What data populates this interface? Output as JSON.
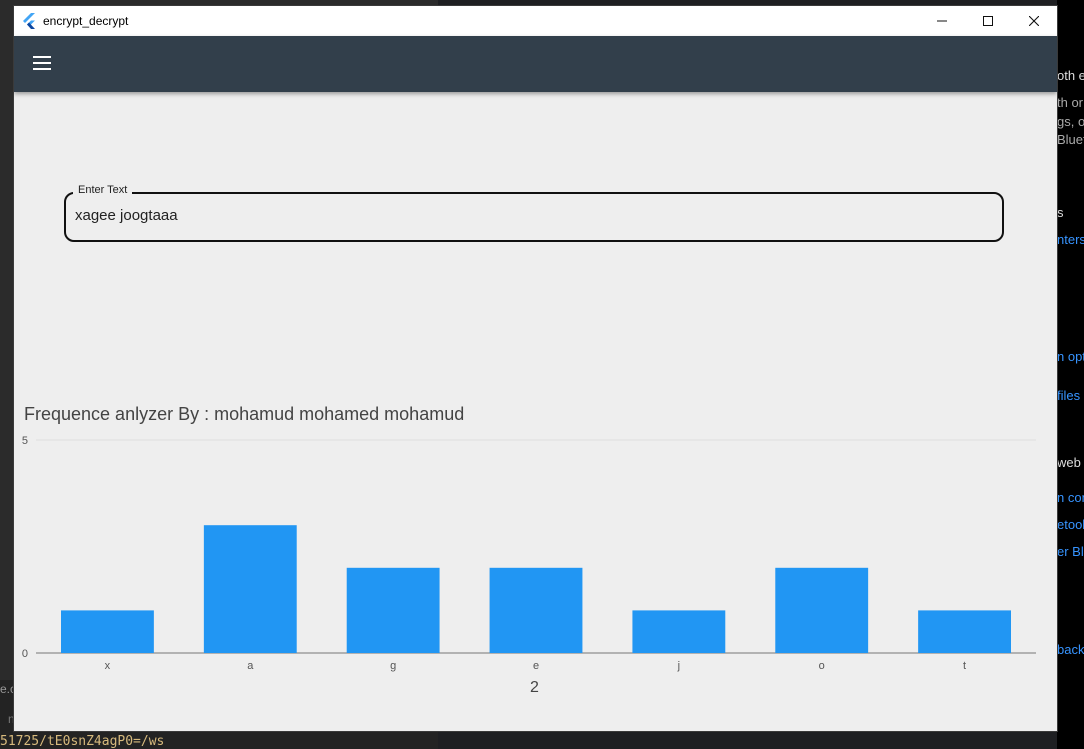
{
  "window": {
    "title": "encrypt_decrypt",
    "controls": [
      "minimize",
      "maximize",
      "close"
    ]
  },
  "appbar": {
    "menu_icon": "hamburger-menu-icon"
  },
  "input": {
    "label": "Enter Text",
    "value": "xagee joogtaaa"
  },
  "chart_title": "Frequence anlyzer By : mohamud mohamed mohamud",
  "page_number": "2",
  "chart_data": {
    "type": "bar",
    "categories": [
      "x",
      "a",
      "g",
      "e",
      "j",
      "o",
      "t"
    ],
    "values": [
      1,
      3,
      2,
      2,
      1,
      2,
      1
    ],
    "ylim": [
      0,
      5
    ],
    "yticks": [
      "0",
      "5"
    ],
    "bar_color": "#2196f3",
    "grid": true
  },
  "background": {
    "right_fragments": [
      {
        "text": "oth e",
        "color": "#dddddd"
      },
      {
        "text": "th or",
        "color": "#aaaaaa"
      },
      {
        "text": "gs, op",
        "color": "#aaaaaa"
      },
      {
        "text": "Blueto",
        "color": "#aaaaaa"
      },
      {
        "text": "s",
        "color": "#dddddd"
      },
      {
        "text": "nters",
        "color": "#3794ff"
      },
      {
        "text": "n opti",
        "color": "#3794ff"
      },
      {
        "text": "files",
        "color": "#3794ff"
      },
      {
        "text": "web",
        "color": "#dddddd"
      },
      {
        "text": "n con",
        "color": "#3794ff"
      },
      {
        "text": "etool",
        "color": "#3794ff"
      },
      {
        "text": "er Bl",
        "color": "#3794ff"
      },
      {
        "text": "back",
        "color": "#3794ff"
      }
    ],
    "terminal_text": "51725/tE0snZ4agP0=/ws",
    "left_fragment_1": "e.c",
    "left_fragment_2": "n"
  },
  "colors": {
    "appbar": "#323f4b",
    "content_bg": "#eeeeee",
    "bar": "#2196f3"
  }
}
